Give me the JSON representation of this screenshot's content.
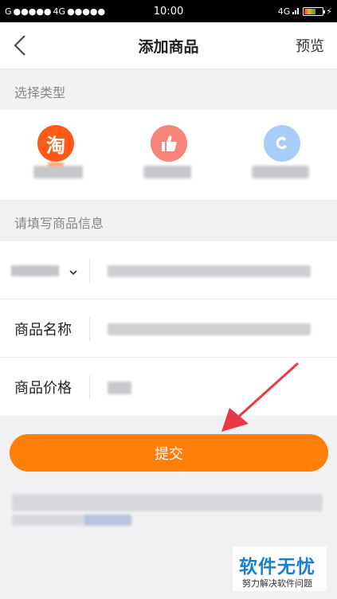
{
  "status_bar": {
    "carrier_left": "G",
    "network_left": "4G",
    "time": "10:00",
    "network_right": "4G"
  },
  "nav": {
    "title": "添加商品",
    "preview": "预览"
  },
  "sections": {
    "type_label": "选择类型",
    "info_label": "请填写商品信息"
  },
  "types": [
    {
      "icon": "taobao-icon",
      "glyph": "淘",
      "color": "#ff5a1a"
    },
    {
      "icon": "thumbs-up-icon",
      "color": "#f6857a"
    },
    {
      "icon": "c-logo-icon",
      "color": "#7fb3f5"
    }
  ],
  "form": {
    "name_label": "商品名称",
    "price_label": "商品价格"
  },
  "submit": {
    "label": "提交"
  },
  "colors": {
    "accent": "#ff7f0a",
    "arrow": "#e8384b"
  },
  "watermark": {
    "title": "软件无忧",
    "subtitle": "努力解决软件问题"
  }
}
